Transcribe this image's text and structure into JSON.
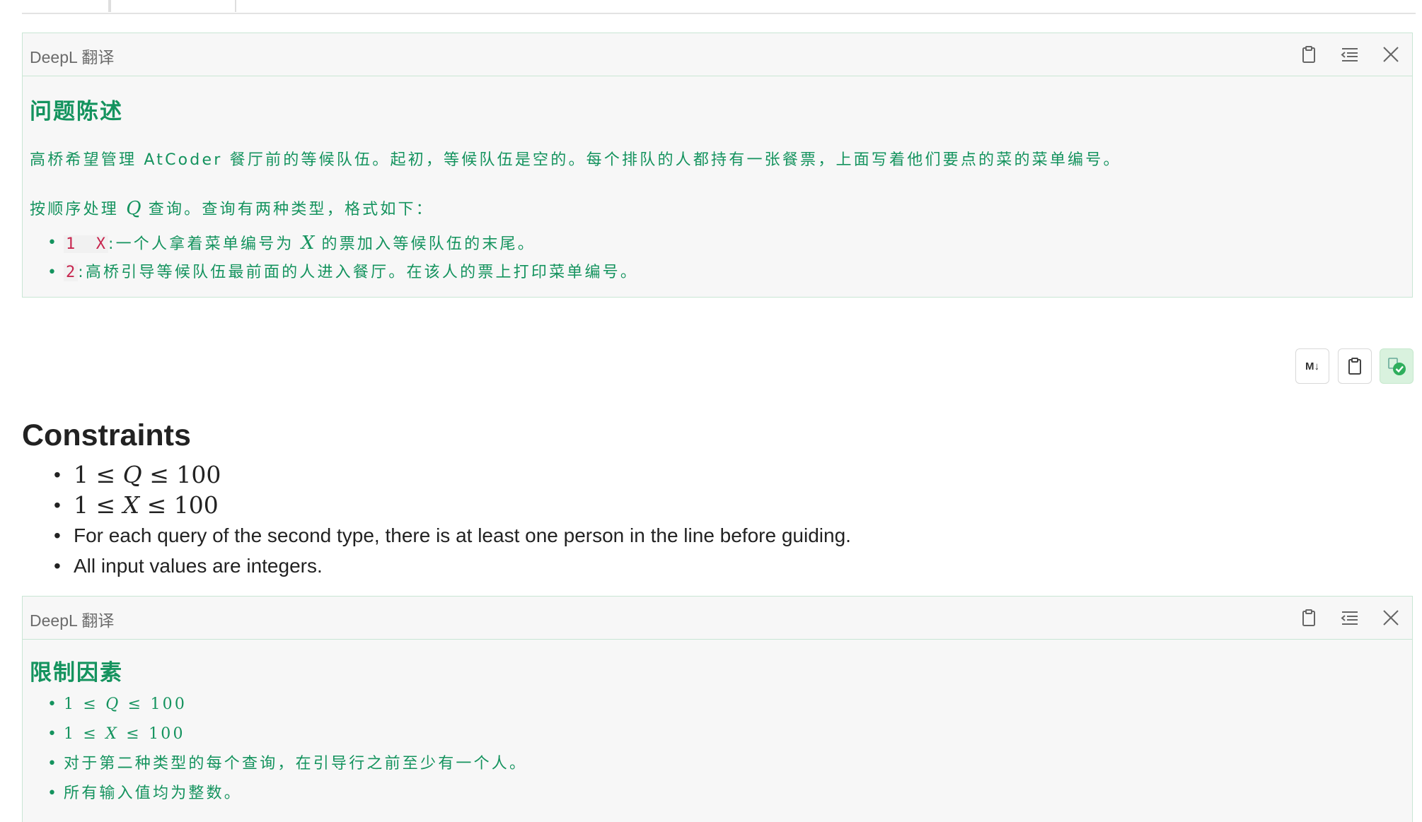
{
  "panel1": {
    "title": "DeepL 翻译",
    "heading": "问题陈述",
    "para1": "高桥希望管理 AtCoder 餐厅前的等候队伍。起初，等候队伍是空的。每个排队的人都持有一张餐票，上面写着他们要点的菜的菜单编号。",
    "para2_pre": "按顺序处理",
    "para2_var": "Q",
    "para2_post": "查询。查询有两种类型，格式如下：",
    "item1_code": "1  X",
    "item1_pre": ":一个人拿着菜单编号为",
    "item1_var": "X",
    "item1_post": "的票加入等候队伍的末尾。",
    "item2_code": "2",
    "item2_text": ":高桥引导等候队伍最前面的人进入餐厅。在该人的票上打印菜单编号。"
  },
  "toolbar": {
    "md_label": "M↓",
    "md_icon": "markdown-icon",
    "clip_icon": "clipboard-icon",
    "done_icon": "translated-check-icon"
  },
  "constraints": {
    "heading": "Constraints",
    "m1_a": "1 ≤ ",
    "m1_var": "Q",
    "m1_b": " ≤ 100",
    "m2_a": "1 ≤ ",
    "m2_var": "X",
    "m2_b": " ≤ 100",
    "line3": "For each query of the second type, there is at least one person in the line before guiding.",
    "line4": "All input values are integers."
  },
  "panel2": {
    "title": "DeepL 翻译",
    "heading": "限制因素",
    "m1_a": "1 ≤ ",
    "m1_var": "Q",
    "m1_b": " ≤ 100",
    "m2_a": "1 ≤ ",
    "m2_var": "X",
    "m2_b": " ≤ 100",
    "line3": "对于第二种类型的每个查询，在引导行之前至少有一个人。",
    "line4": "所有输入值均为整数。"
  },
  "colors": {
    "translation_green": "#14935e",
    "panel_border": "#c9e6d4",
    "panel_bg": "#f7f7f7",
    "code_red": "#c7254e"
  }
}
